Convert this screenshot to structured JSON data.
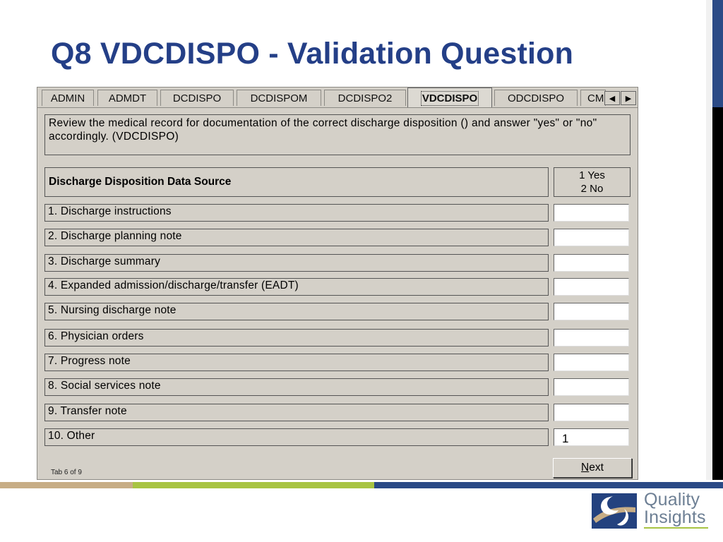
{
  "slide": {
    "title": "Q8 VDCDISPO - Validation Question"
  },
  "dialog": {
    "tabs": [
      {
        "label": "ADMIN",
        "active": false
      },
      {
        "label": "ADMDT",
        "active": false
      },
      {
        "label": "DCDISPO",
        "active": false
      },
      {
        "label": "DCDISPOM",
        "active": false
      },
      {
        "label": "DCDISPO2",
        "active": false
      },
      {
        "label": "VDCDISPO",
        "active": true
      },
      {
        "label": "ODCDISPO",
        "active": false
      },
      {
        "label": "CM",
        "active": false
      }
    ],
    "instruction": "Review the medical record for documentation of the correct discharge disposition () and answer \"yes\" or \"no\" accordingly. (VDCDISPO)",
    "table_header": {
      "label": "Discharge Disposition Data Source",
      "option_yes": "1 Yes",
      "option_no": "2 No"
    },
    "rows": [
      {
        "label": "1. Discharge instructions",
        "value": ""
      },
      {
        "label": "2.  Discharge  planning  note",
        "value": ""
      },
      {
        "label": "3. Discharge summary",
        "value": ""
      },
      {
        "label": "4. Expanded admission/discharge/transfer (EADT)",
        "value": ""
      },
      {
        "label": "5. Nursing discharge note",
        "value": ""
      },
      {
        "label": "6. Physician orders",
        "value": ""
      },
      {
        "label": "7. Progress note",
        "value": ""
      },
      {
        "label": "8. Social services note",
        "value": ""
      },
      {
        "label": "9. Transfer note",
        "value": ""
      },
      {
        "label": "10. Other",
        "value": "1"
      }
    ],
    "tab_counter": "Tab 6 of 9",
    "next_button": {
      "mnemonic": "N",
      "rest": "ext"
    }
  },
  "footer": {
    "logo_line1": "Quality",
    "logo_line2": "Insights",
    "colors": {
      "tan": "#c7ad86",
      "green": "#a8c443",
      "blue": "#2b4a86"
    }
  },
  "icons": [
    "tab-scroll-left-icon",
    "tab-scroll-right-icon",
    "quality-insights-logo-icon"
  ]
}
